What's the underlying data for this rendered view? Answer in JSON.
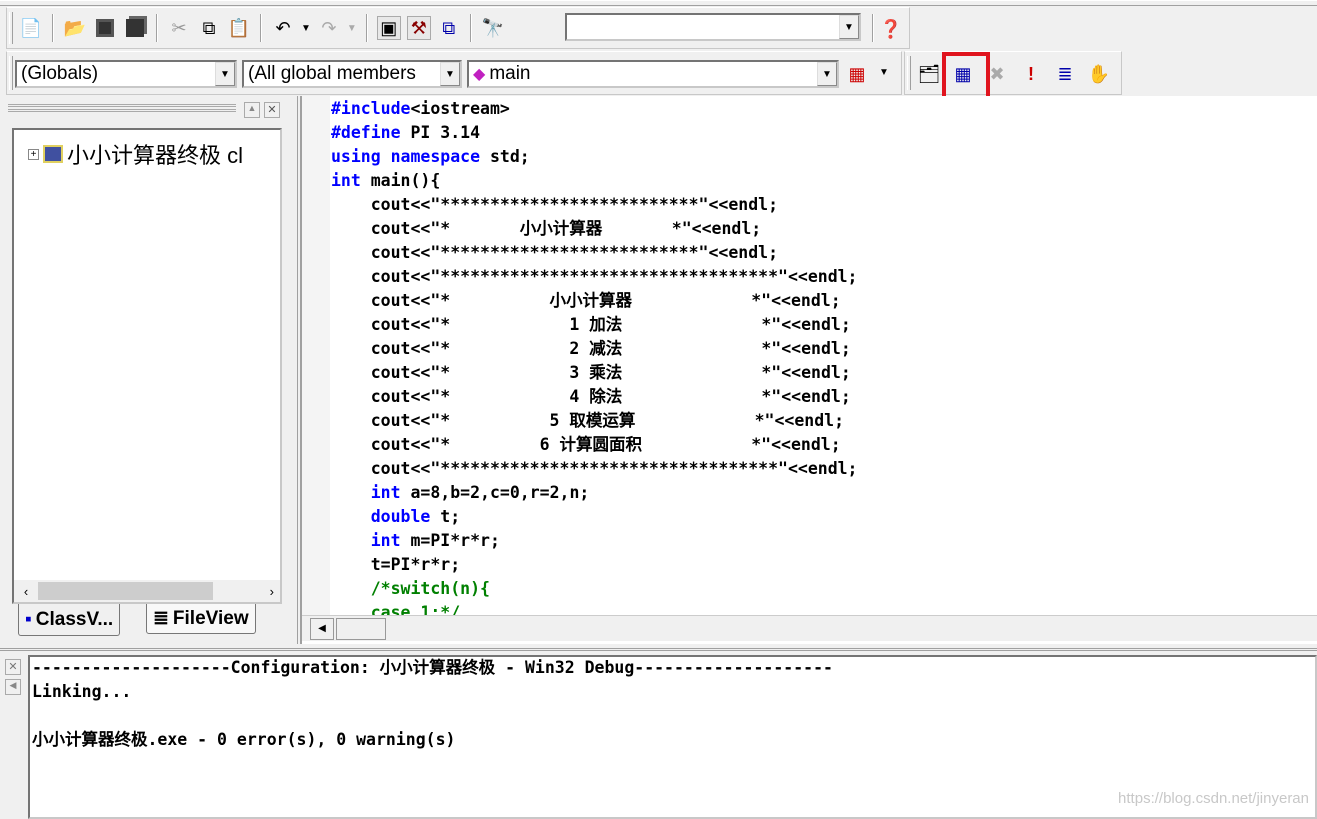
{
  "toolbar_standard": {
    "icons": [
      "new-text-file-icon",
      "open-icon",
      "save-icon",
      "save-all-icon",
      "cut-icon",
      "copy-icon",
      "paste-icon",
      "undo-icon",
      "redo-icon",
      "workspace-icon",
      "output-icon",
      "window-list-icon",
      "find-in-files-icon",
      "search-help-icon"
    ],
    "find_value": ""
  },
  "toolbar_wizard": {
    "class_combo": "(Globals)",
    "member_filter_combo": "(All global members",
    "member_combo": "main"
  },
  "toolbar_build": {
    "icons": [
      "compile-icon",
      "build-icon",
      "stop-build-icon",
      "execute-icon",
      "go-icon",
      "breakpoint-icon"
    ],
    "highlight_color": "#e0141e"
  },
  "workspace": {
    "tree_item": "小小计算器终极 cl",
    "tabs": [
      {
        "label": "ClassV..."
      },
      {
        "label": "FileView"
      }
    ]
  },
  "editor": {
    "lines": [
      [
        {
          "t": "#include",
          "c": "k"
        },
        {
          "t": "<iostream>"
        }
      ],
      [
        {
          "t": "#define",
          "c": "k"
        },
        {
          "t": " PI 3.14"
        }
      ],
      [
        {
          "t": "using namespace",
          "c": "k"
        },
        {
          "t": " std;"
        }
      ],
      [
        {
          "t": "int",
          "c": "k"
        },
        {
          "t": " main(){"
        }
      ],
      [
        {
          "t": "    cout<<\"**************************\"<<endl;"
        }
      ],
      [
        {
          "t": "    cout<<\"*       小小计算器       *\"<<endl;"
        }
      ],
      [
        {
          "t": "    cout<<\"**************************\"<<endl;"
        }
      ],
      [
        {
          "t": "    cout<<\"**********************************\"<<endl;"
        }
      ],
      [
        {
          "t": "    cout<<\"*          小小计算器            *\"<<endl;"
        }
      ],
      [
        {
          "t": "    cout<<\"*            1 加法              *\"<<endl;"
        }
      ],
      [
        {
          "t": "    cout<<\"*            2 减法              *\"<<endl;"
        }
      ],
      [
        {
          "t": "    cout<<\"*            3 乘法              *\"<<endl;"
        }
      ],
      [
        {
          "t": "    cout<<\"*            4 除法              *\"<<endl;"
        }
      ],
      [
        {
          "t": "    cout<<\"*          5 取模运算            *\"<<endl;"
        }
      ],
      [
        {
          "t": "    cout<<\"*         6 计算圆面积           *\"<<endl;"
        }
      ],
      [
        {
          "t": "    cout<<\"**********************************\"<<endl;"
        }
      ],
      [
        {
          "t": "    "
        },
        {
          "t": "int",
          "c": "k"
        },
        {
          "t": " a=8,b=2,c=0,r=2,n;"
        }
      ],
      [
        {
          "t": "    "
        },
        {
          "t": "double",
          "c": "k"
        },
        {
          "t": " t;"
        }
      ],
      [
        {
          "t": "    "
        },
        {
          "t": "int",
          "c": "k"
        },
        {
          "t": " m=PI*r*r;"
        }
      ],
      [
        {
          "t": "    t=PI*r*r;"
        }
      ],
      [
        {
          "t": "    /*switch(n){",
          "c": "c"
        }
      ],
      [
        {
          "t": "    case 1:*/",
          "c": "c"
        }
      ]
    ]
  },
  "output": {
    "lines": [
      "--------------------Configuration: 小小计算器终极 - Win32 Debug--------------------",
      "Linking...",
      "",
      "小小计算器终极.exe - 0 error(s), 0 warning(s)"
    ]
  },
  "watermark": "https://blog.csdn.net/jinyeran"
}
